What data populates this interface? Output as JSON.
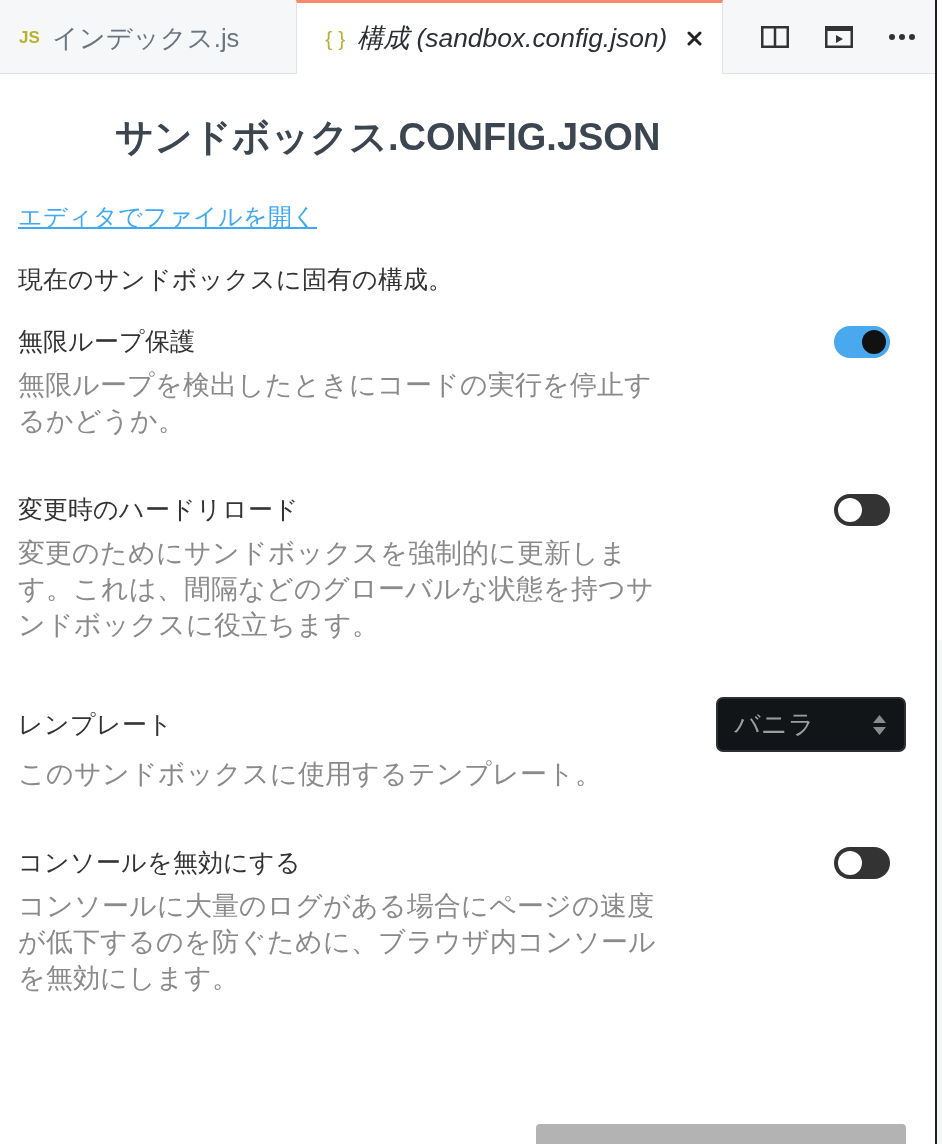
{
  "tabs": [
    {
      "icon_text": "JS",
      "label": "インデックス.js",
      "selected": false,
      "preview": false,
      "closable": false
    },
    {
      "icon_text": "{ }",
      "label": "構成 (sandbox.config.json)",
      "selected": true,
      "preview": true,
      "closable": true
    }
  ],
  "config": {
    "title": "サンドボックス.CONFIG.JSON",
    "open_link": "エディタでファイルを開く",
    "intro": "現在のサンドボックスに固有の構成。",
    "settings": [
      {
        "kind": "toggle",
        "label": "無限ループ保護",
        "on": true,
        "description": "無限ループを検出したときにコードの実行を停止するかどうか。"
      },
      {
        "kind": "toggle",
        "label": "変更時のハードリロード",
        "on": false,
        "description": "変更のためにサンドボックスを強制的に更新します。これは、間隔などのグローバルな状態を持つサンドボックスに役立ちます。"
      },
      {
        "kind": "select",
        "label": "レンプレート",
        "value": "バニラ",
        "description": "このサンドボックスに使用するテンプレート。"
      },
      {
        "kind": "toggle",
        "label": "コンソールを無効にする",
        "on": false,
        "description": "コンソールに大量のログがある場合にページの速度が低下するのを防ぐために、ブラウザ内コンソールを無効にします。"
      }
    ]
  }
}
